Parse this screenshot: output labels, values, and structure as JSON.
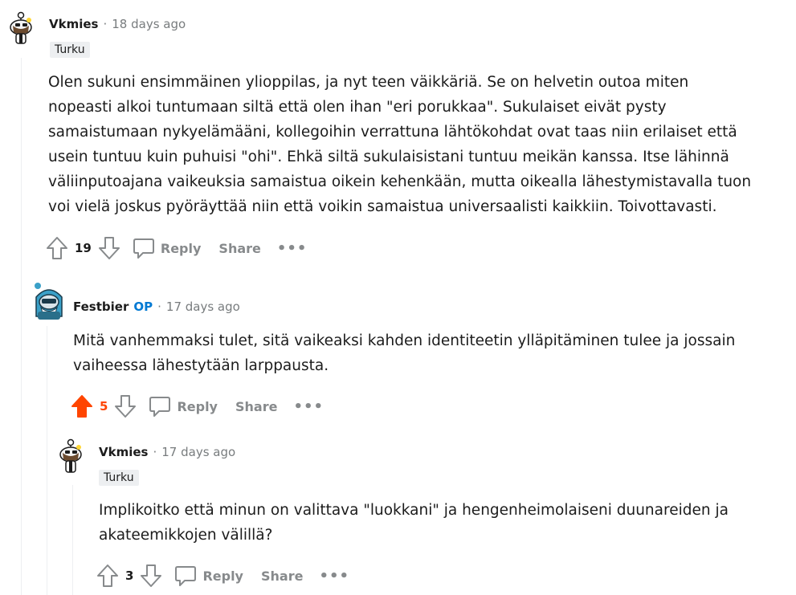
{
  "comments": [
    {
      "author": "Vkmies",
      "time": "18 days ago",
      "flair": "Turku",
      "body": [
        "Olen sukuni ensimmäinen ylioppilas, ja nyt teen väikkäriä. Se on helvetin outoa miten",
        "nopeasti alkoi tuntumaan siltä että olen ihan \"eri porukkaa\". Sukulaiset eivät pysty",
        "samaistumaan nykyelämääni, kollegoihin verrattuna lähtökohdat ovat taas niin erilaiset että",
        "usein tuntuu kuin puhuisi \"ohi\". Ehkä siltä sukulaisistani tuntuu meikän kanssa. Itse lähinnä",
        "väliinputoajana vaikeuksia samaistua oikein kehenkään, mutta oikealla lähestymistavalla tuon",
        "voi vielä joskus pyöräyttää niin että voikin samaistua universaalisti kaikkiin. Toivottavasti."
      ],
      "score": "19",
      "upvoted": false
    },
    {
      "author": "Festbier",
      "op_badge": "OP",
      "time": "17 days ago",
      "body": [
        "Mitä vanhemmaksi tulet, sitä vaikeaksi kahden identiteetin ylläpitäminen tulee ja jossain",
        "vaiheessa lähestytään larppausta."
      ],
      "score": "5",
      "upvoted": true
    },
    {
      "author": "Vkmies",
      "time": "17 days ago",
      "flair": "Turku",
      "body": [
        "Implikoitko että minun on valittava \"luokkani\" ja hengenheimolaiseni duunareiden ja",
        "akateemikkojen välillä?"
      ],
      "score": "3",
      "upvoted": false
    }
  ],
  "actions": {
    "reply": "Reply",
    "share": "Share",
    "more": "•••"
  },
  "separator": "·",
  "colors": {
    "upvote_active": "#ff4500",
    "op": "#0079d3",
    "muted": "#878a8c"
  }
}
